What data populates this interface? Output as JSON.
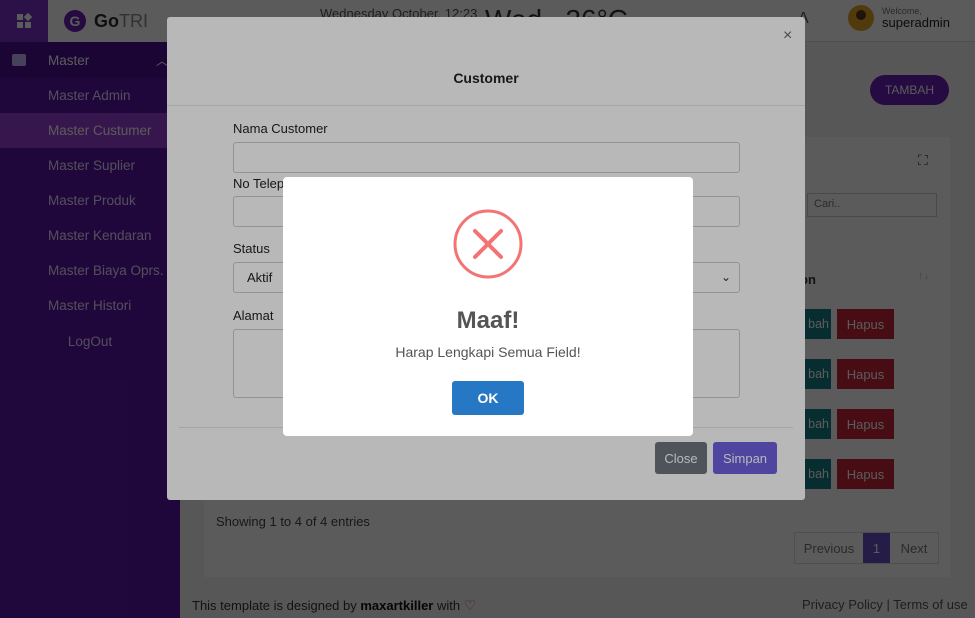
{
  "sidebar": {
    "logo_text": "Go",
    "logo_text_light": "TRI",
    "group_label": "Master",
    "items": [
      {
        "label": "Master Admin"
      },
      {
        "label": "Master Custumer"
      },
      {
        "label": "Master Suplier"
      },
      {
        "label": "Master Produk"
      },
      {
        "label": "Master Kendaran"
      },
      {
        "label": "Master Biaya Oprs."
      },
      {
        "label": "Master Histori"
      }
    ],
    "logout_label": "LogOut"
  },
  "topbar": {
    "date_text": "Wednesday October, 12:23",
    "big_text": "Wed",
    "big_temp": "26°C",
    "welcome_label": "Welcome,",
    "username": "superadmin"
  },
  "page": {
    "tambah_label": "TAMBAH",
    "search_placeholder": "Cari..",
    "column_header": "on",
    "rows": [
      {
        "ubah_label": "bah",
        "hapus_label": "Hapus"
      },
      {
        "ubah_label": "bah",
        "hapus_label": "Hapus"
      },
      {
        "ubah_label": "bah",
        "hapus_label": "Hapus"
      },
      {
        "ubah_label": "bah",
        "hapus_label": "Hapus"
      }
    ],
    "showing_text": "Showing 1 to 4 of 4 entries",
    "pagination": {
      "previous": "Previous",
      "current": "1",
      "next": "Next"
    },
    "footer": {
      "prefix": "This template is designed by ",
      "author": "maxartkiller",
      "suffix": " with ",
      "privacy": "Privacy Policy",
      "separator": " | ",
      "terms": "Terms of use"
    }
  },
  "modal": {
    "title": "Customer",
    "close_glyph": "×",
    "fields": {
      "nama_label": "Nama Customer",
      "nama_value": "",
      "telepon_label": "No Telep",
      "telepon_value": "",
      "status_label": "Status",
      "status_value": "Aktif",
      "alamat_label": "Alamat",
      "alamat_value": ""
    },
    "close_button": "Close",
    "save_button": "Simpan"
  },
  "alert": {
    "icon": "error-x-icon",
    "title": "Maaf!",
    "message": "Harap Lengkapi Semua Field!",
    "ok_label": "OK",
    "icon_color": "#f27474",
    "ok_color": "#2778c4"
  }
}
